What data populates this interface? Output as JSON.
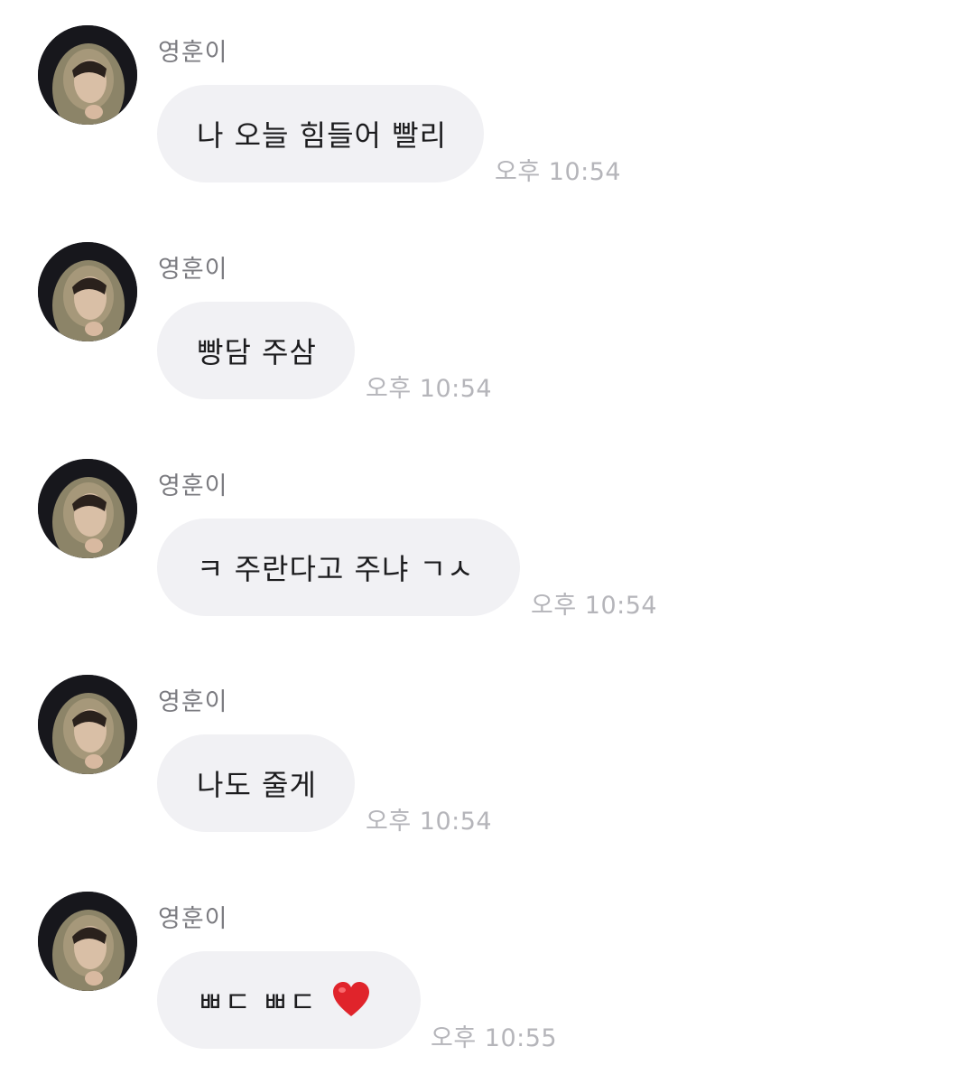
{
  "chat": {
    "messages": [
      {
        "sender": "영훈이",
        "text": "나 오늘 힘들어 빨리",
        "time": "오후 10:54"
      },
      {
        "sender": "영훈이",
        "text": "빵담 주삼",
        "time": "오후 10:54"
      },
      {
        "sender": "영훈이",
        "text": "ㅋ 주란다고 주냐 ㄱㅅ",
        "time": "오후 10:54"
      },
      {
        "sender": "영훈이",
        "text": "나도 줄게",
        "time": "오후 10:54"
      },
      {
        "sender": "영훈이",
        "text": "ㅃㄷ ㅃㄷ",
        "time": "오후 10:55",
        "emoji": "red-heart-emoji"
      }
    ]
  },
  "colors": {
    "bubble_bg": "#f1f1f4",
    "sender_text": "#7b7b80",
    "time_text": "#b5b5ba",
    "message_text": "#1c1c1e",
    "heart": "#e0242b"
  }
}
